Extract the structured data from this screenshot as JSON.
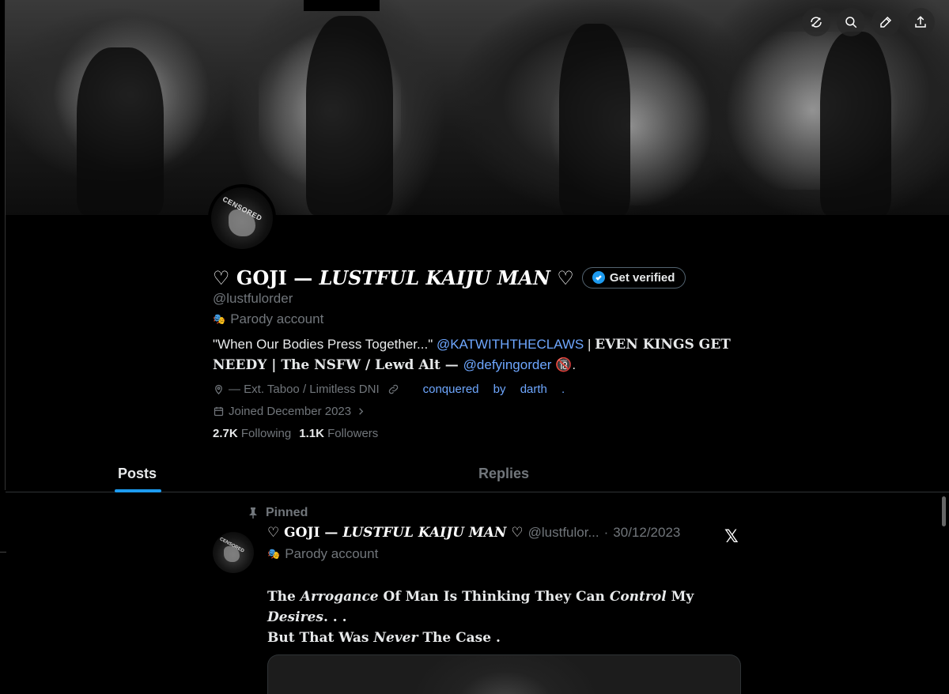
{
  "header": {
    "actions": [
      {
        "icon": "unfollow-sync-icon"
      },
      {
        "icon": "search-icon"
      },
      {
        "icon": "edit-icon"
      },
      {
        "icon": "share-icon"
      }
    ]
  },
  "profile": {
    "avatar_stamp": "CENSORED",
    "name_prefix": "♡ GOJI — ",
    "name_italic": "LUSTFUL KAIJU MAN",
    "name_suffix": " ♡",
    "verify_button": "Get verified",
    "handle": "@lustfulorder",
    "parody_label": "Parody account",
    "bio": {
      "part1": "\"When Our Bodies Press Together...\" ",
      "mention1": "@KATWITHTHECLAWS",
      "part2": " | ",
      "serif1": "EVEN KINGS GET NEEDY | The NSFW / Lewd Alt — ",
      "mention2": "@defyingorder",
      "part3": " 🔞."
    },
    "location": "— Ext. Taboo / Limitless DNI",
    "website": "conquered by darth .",
    "joined": "Joined December 2023",
    "following_count": "2.7K",
    "following_label": "Following",
    "followers_count": "1.1K",
    "followers_label": "Followers"
  },
  "tabs": [
    {
      "label": "Posts",
      "active": true
    },
    {
      "label": "Replies",
      "active": false
    }
  ],
  "post": {
    "pinned_label": "Pinned",
    "name_prefix": "♡ GOJI — ",
    "name_italic": "LUSTFUL KAIJU MAN",
    "name_suffix": " ♡",
    "handle": "@lustfulor...",
    "separator": "·",
    "date": "30/12/2023",
    "parody_label": "Parody account",
    "x_logo": "𝕏",
    "text": {
      "t1": "The ",
      "i1": "Arrogance",
      "t2": " Of Man Is Thinking They Can ",
      "i2": "Control",
      "t3": " My ",
      "i3": "Desires",
      "t4": ". . .",
      "t5": "But That Was ",
      "i4": "Never",
      "t6": " The Case ."
    }
  },
  "colors": {
    "accent": "#1d9bf0",
    "link": "#6ea7ff",
    "muted": "#71767b",
    "background": "#000000"
  }
}
